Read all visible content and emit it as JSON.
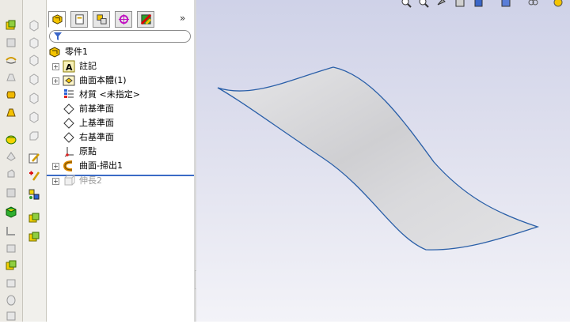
{
  "feature_tree": {
    "root": {
      "label": "零件1"
    },
    "items": [
      {
        "label": "註記",
        "icon": "annotation-icon",
        "expandable": true
      },
      {
        "label": "曲面本體(1)",
        "icon": "surface-bodies-icon",
        "expandable": true
      },
      {
        "label": "材質 <未指定>",
        "icon": "material-icon",
        "expandable": false
      },
      {
        "label": "前基準面",
        "icon": "plane-icon",
        "expandable": false
      },
      {
        "label": "上基準面",
        "icon": "plane-icon",
        "expandable": false
      },
      {
        "label": "右基準面",
        "icon": "plane-icon",
        "expandable": false
      },
      {
        "label": "原點",
        "icon": "origin-icon",
        "expandable": false
      },
      {
        "label": "曲面-掃出1",
        "icon": "surface-sweep-icon",
        "expandable": true
      },
      {
        "label": "伸長2",
        "icon": "extrude-icon",
        "expandable": true,
        "suppressed": true
      }
    ]
  },
  "panel_tabs": [
    "feature-manager",
    "property-manager",
    "configuration-manager",
    "dimxpert-manager",
    "display-manager"
  ],
  "expand_symbol": "»",
  "colors": {
    "rollback_bar": "#3b6bc6",
    "surface_edge": "#2a5fa8",
    "viewport_top": "#cfd2e8",
    "viewport_bottom": "#f3f3f8"
  }
}
